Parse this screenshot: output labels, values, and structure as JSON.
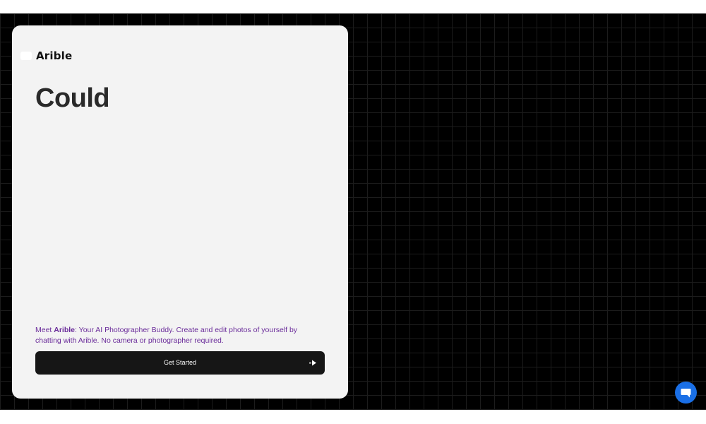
{
  "brand": {
    "name": "Arible"
  },
  "hero": {
    "headline": "Could"
  },
  "intro": {
    "prefix": "Meet ",
    "brand_name": "Arible",
    "text": ": Your AI Photographer Buddy. Create and edit photos of yourself by chatting with Arible. No camera or photographer required."
  },
  "cta": {
    "label": "Get Started",
    "icon": "arrow-right-icon"
  },
  "chat": {
    "icon": "chat-bubble-icon"
  },
  "colors": {
    "page_background": "#000000",
    "card_background": "#f3f3f3",
    "button_background": "#161616",
    "tagline_text": "#6a2c9a",
    "chat_accent": "#1a6fe6"
  }
}
